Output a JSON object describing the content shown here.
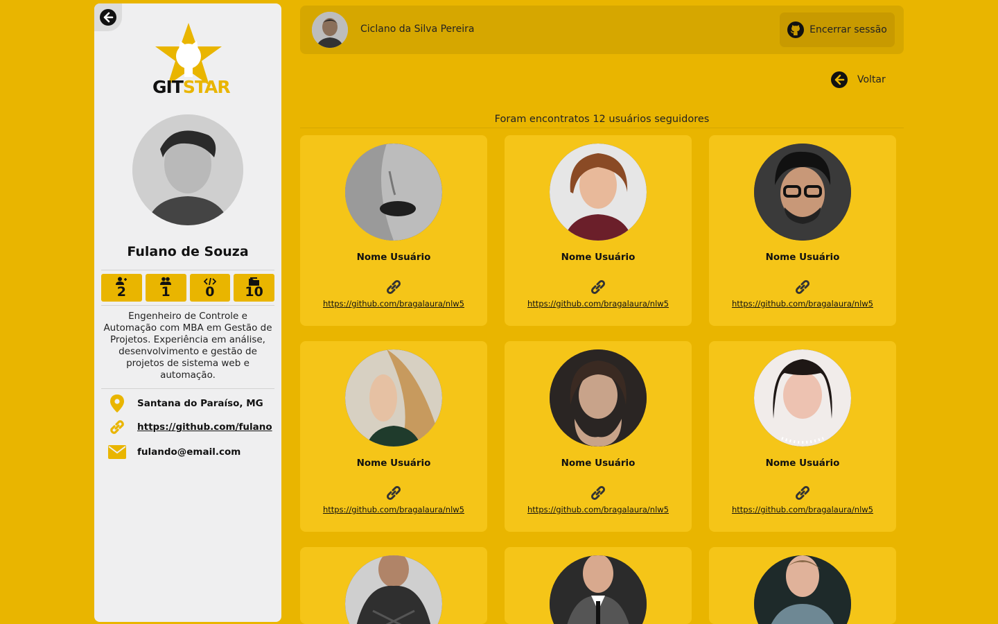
{
  "app": {
    "logo_git": "GIT",
    "logo_star": "STAR"
  },
  "profile": {
    "name": "Fulano de Souza",
    "stats": [
      {
        "icon": "user-follow-icon",
        "value": "2"
      },
      {
        "icon": "users-icon",
        "value": "1"
      },
      {
        "icon": "code-icon",
        "value": "0"
      },
      {
        "icon": "folder-icon",
        "value": "10"
      }
    ],
    "bio": "Engenheiro de Controle e Automação com MBA em Gestão de Projetos. Experiência em análise, desenvolvimento e gestão de projetos de sistema web e automação.",
    "location": "Santana do Paraíso, MG",
    "github": "https://github.com/fulano",
    "email": "fulando@email.com"
  },
  "header": {
    "user_name": "Ciclano da Silva Pereira",
    "logout_label": "Encerrar sessão"
  },
  "nav": {
    "back_label": "Voltar"
  },
  "results": {
    "summary": "Foram encontratos 12 usuários seguidores"
  },
  "followers": [
    {
      "name": "Nome Usuário",
      "url": "https://github.com/bragalaura/nlw5"
    },
    {
      "name": "Nome Usuário",
      "url": "https://github.com/bragalaura/nlw5"
    },
    {
      "name": "Nome Usuário",
      "url": "https://github.com/bragalaura/nlw5"
    },
    {
      "name": "Nome Usuário",
      "url": "https://github.com/bragalaura/nlw5"
    },
    {
      "name": "Nome Usuário",
      "url": "https://github.com/bragalaura/nlw5"
    },
    {
      "name": "Nome Usuário",
      "url": "https://github.com/bragalaura/nlw5"
    },
    {
      "name": "",
      "url": ""
    },
    {
      "name": "",
      "url": ""
    },
    {
      "name": "",
      "url": ""
    }
  ],
  "colors": {
    "accent": "#E9B500",
    "card": "#F5C518",
    "sidebar": "#EFEFF0"
  }
}
